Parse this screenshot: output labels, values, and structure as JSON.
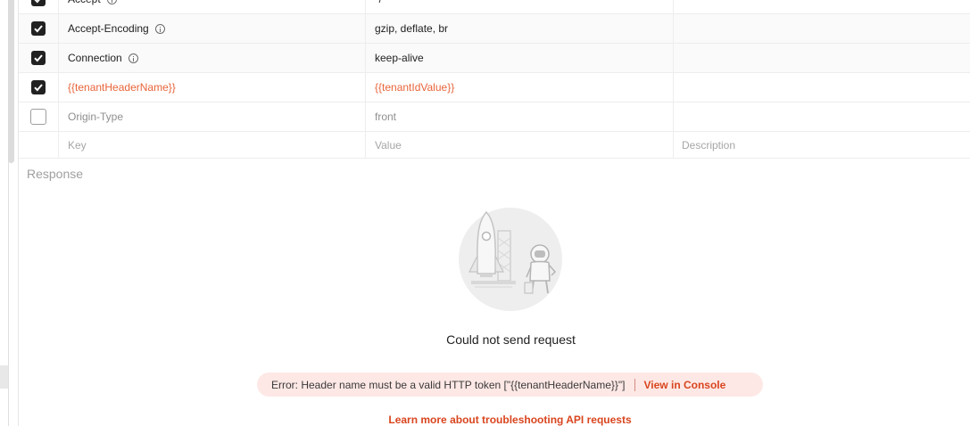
{
  "headers": {
    "rows": [
      {
        "key": "Accept",
        "value": "*/*",
        "description": "",
        "checked": true,
        "info": true,
        "style": "normal"
      },
      {
        "key": "Accept-Encoding",
        "value": "gzip, deflate, br",
        "description": "",
        "checked": true,
        "info": true,
        "style": "normal"
      },
      {
        "key": "Connection",
        "value": "keep-alive",
        "description": "",
        "checked": true,
        "info": true,
        "style": "normal"
      },
      {
        "key": "{{tenantHeaderName}}",
        "value": "{{tenantIdValue}}",
        "description": "",
        "checked": true,
        "info": false,
        "style": "variable"
      },
      {
        "key": "Origin-Type",
        "value": "front",
        "description": "",
        "checked": false,
        "info": false,
        "style": "disabled"
      }
    ],
    "placeholder": {
      "key": "Key",
      "value": "Value",
      "description": "Description"
    }
  },
  "response": {
    "label": "Response",
    "message": "Could not send request",
    "error_text": "Error: Header name must be a valid HTTP token [\"{{tenantHeaderName}}\"]",
    "console_link": "View in Console",
    "learn_more": "Learn more about troubleshooting API requests",
    "illustration_icon": "rocket-astronaut-illustration"
  },
  "colors": {
    "accent": "#d9451f",
    "variable": "#e8643a",
    "error_bg": "#fde8e5"
  }
}
